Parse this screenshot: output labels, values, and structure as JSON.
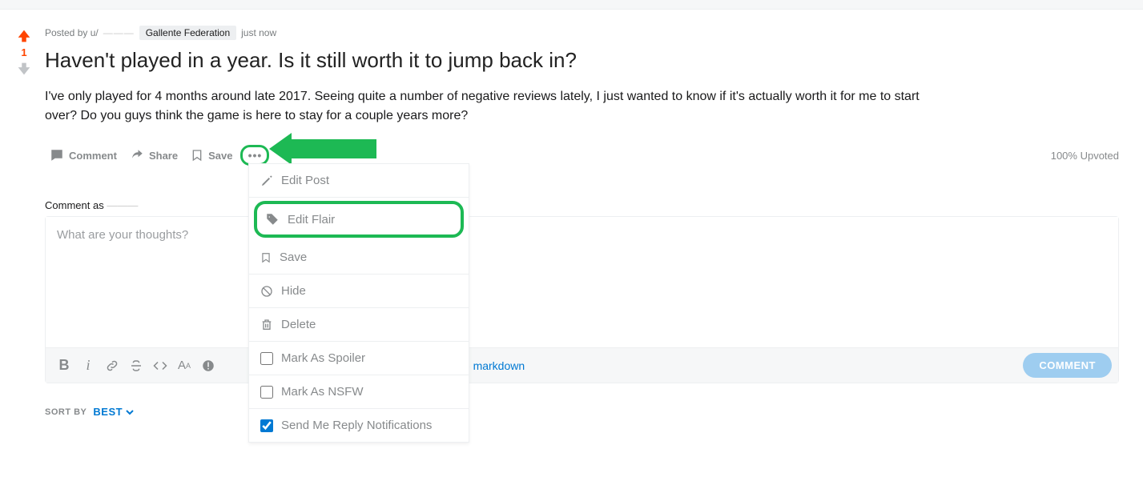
{
  "post": {
    "posted_by_prefix": "Posted by u/",
    "username": "———",
    "flair": "Gallente Federation",
    "time": "just now",
    "title": "Haven't played in a year. Is it still worth it to jump back in?",
    "body": "I've only played for 4 months around late 2017. Seeing quite a number of negative reviews lately, I just wanted to know if it's actually worth it for me to start over? Do you guys think the game is here to stay for a couple years more?",
    "vote_count": "1",
    "upvoted_text": "100% Upvoted"
  },
  "actions": {
    "comment": "Comment",
    "share": "Share",
    "save": "Save",
    "more": "•••"
  },
  "dropdown": {
    "edit_post": "Edit Post",
    "edit_flair": "Edit Flair",
    "save": "Save",
    "hide": "Hide",
    "delete": "Delete",
    "mark_spoiler": "Mark As Spoiler",
    "mark_nsfw": "Mark As NSFW",
    "reply_notifications": "Send Me Reply Notifications",
    "spoiler_checked": false,
    "nsfw_checked": false,
    "notifications_checked": true
  },
  "comment_box": {
    "label_prefix": "Comment as ",
    "username": "———",
    "placeholder": "What are your thoughts?",
    "switch_mode": "to markdown",
    "submit": "COMMENT"
  },
  "toolbar": {
    "bold": "B",
    "italic": "i"
  },
  "sort": {
    "label": "SORT BY",
    "value": "BEST"
  }
}
